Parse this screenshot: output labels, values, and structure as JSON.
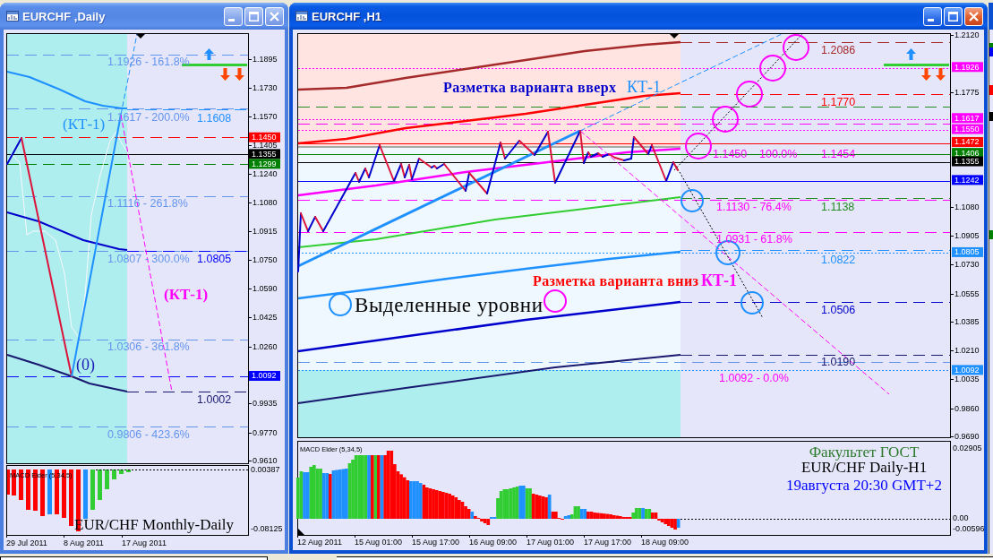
{
  "windows": [
    {
      "title": "EURCHF ,Daily",
      "active": false,
      "price_ticks": [
        "1.1895",
        "1.1730",
        "1.1570",
        "1.1405",
        "1.1240",
        "1.1080",
        "1.0915",
        "1.0750",
        "1.0590",
        "1.0425",
        "1.0260",
        "0.9935",
        "0.9770",
        "0.9610"
      ],
      "price_tags": [
        {
          "text": "1.1450",
          "color": "#ff0000"
        },
        {
          "text": "1.1355",
          "color": "#000000"
        },
        {
          "text": "1.1299",
          "color": "#008000"
        },
        {
          "text": "1.0092",
          "color": "#0000ff"
        }
      ],
      "level_labels": [
        {
          "text": "1.1926 - 161.8%",
          "color": "#6495ed"
        },
        {
          "text": "1.1617 - 200.0%",
          "color": "#6495ed"
        },
        {
          "text": "1.1608",
          "color": "#1e90ff"
        },
        {
          "text": "1.1116 - 261.8%",
          "color": "#6495ed"
        },
        {
          "text": "1.0807 - 300.0%",
          "color": "#6495ed"
        },
        {
          "text": "1.0805",
          "color": "#0000ff"
        },
        {
          "text": "1.0306 - 361.8%",
          "color": "#6495ed"
        },
        {
          "text": "1.0002",
          "color": "#191970"
        },
        {
          "text": "0.9806 - 423.6%",
          "color": "#6495ed"
        }
      ],
      "annotations": [
        {
          "text": "(КТ-1)",
          "color": "#1e90ff"
        },
        {
          "text": "(0)",
          "color": "#1c1cb4"
        },
        {
          "text": "(КТ-1)",
          "color": "#ff00ff"
        }
      ],
      "indicator": {
        "title": "MACD Elder (5,34,5)",
        "ticks": [
          "0.00387",
          "-0.08125"
        ]
      },
      "captions": [
        {
          "text": "EUR/CHF Monthly-Daily",
          "color": "#000000"
        }
      ],
      "time_ticks": [
        "29 Jul 2011",
        "8 Aug 2011",
        "17 Aug 2011"
      ]
    },
    {
      "title": "EURCHF ,H1",
      "active": true,
      "price_ticks": [
        "1.2120",
        "1.1775",
        "1.1080",
        "1.0905",
        "1.0730",
        "1.0555",
        "1.0385",
        "1.0210",
        "1.0035",
        "0.9860",
        "0.9690"
      ],
      "price_tags": [
        {
          "text": "1.1926",
          "color": "#ff00ff"
        },
        {
          "text": "1.1617",
          "color": "#ff00ff"
        },
        {
          "text": "1.1550",
          "color": "#ff00ff"
        },
        {
          "text": "1.1472",
          "color": "#ff0000"
        },
        {
          "text": "1.1406",
          "color": "#008000"
        },
        {
          "text": "1.1355",
          "color": "#000000"
        },
        {
          "text": "1.1242",
          "color": "#0000ff"
        },
        {
          "text": "1.0805",
          "color": "#1e90ff"
        },
        {
          "text": "1.0092",
          "color": "#1e90ff"
        }
      ],
      "level_labels": [
        {
          "text": "1.2086",
          "color": "#a52a2a"
        },
        {
          "text": "1.1770",
          "color": "#ff0000"
        },
        {
          "text": "1.1450",
          "color": "#ff00ff"
        },
        {
          "text": "100.0%",
          "color": "#ff00ff"
        },
        {
          "text": "1.1454",
          "color": "#ff00ff"
        },
        {
          "text": "1.1130 - 76.4%",
          "color": "#ff00ff"
        },
        {
          "text": "1.1138",
          "color": "#228b22"
        },
        {
          "text": "1.0931 - 61.8%",
          "color": "#ff00ff"
        },
        {
          "text": "1.0822",
          "color": "#1e90ff"
        },
        {
          "text": "1.0506",
          "color": "#0000cd"
        },
        {
          "text": "1.0190",
          "color": "#191970"
        },
        {
          "text": "1.0092 - 0.0%",
          "color": "#ff00ff"
        }
      ],
      "annotations": [
        {
          "text": "Разметка варианта вверх",
          "color": "#0000cd"
        },
        {
          "text": "КТ-1",
          "color": "#1e90ff"
        },
        {
          "text": "Разметка варианта вниз",
          "color": "#ff0000"
        },
        {
          "text": "КТ-1",
          "color": "#ff00ff"
        },
        {
          "text": "Выделенные уровни",
          "color": "#000000"
        }
      ],
      "indicator": {
        "title": "MACD Elder (5,34,5)",
        "ticks": [
          "0.02905",
          "0.00",
          "-0.00596"
        ]
      },
      "captions": [
        {
          "text": "Факультет ГОСТ",
          "color": "#2b7a2b"
        },
        {
          "text": "EUR/CHF Daily-H1",
          "color": "#000000"
        },
        {
          "text": "19августа 20:30 GMT+2",
          "color": "#0000ff"
        }
      ],
      "time_ticks": [
        "12 Aug 2011",
        "15 Aug 01:00",
        "15 Aug 17:00",
        "16 Aug 09:00",
        "17 Aug 01:00",
        "17 Aug 17:00",
        "18 Aug 09:00"
      ]
    }
  ]
}
